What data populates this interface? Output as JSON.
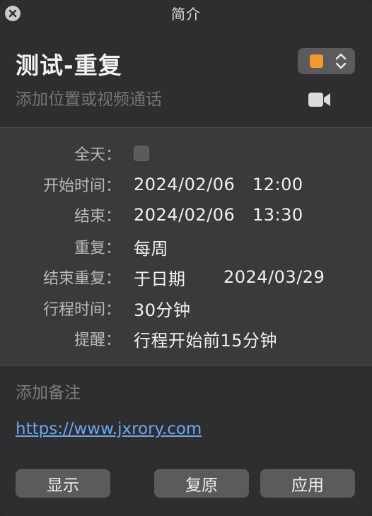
{
  "window": {
    "title": "简介"
  },
  "header": {
    "event_title": "测试-重复",
    "calendar_color": "#f39a2c",
    "location_placeholder": "添加位置或视频通话"
  },
  "details": {
    "all_day_label": "全天：",
    "start_label": "开始时间：",
    "start_date": "2024/02/06",
    "start_time": "12:00",
    "end_label": "结束：",
    "end_date": "2024/02/06",
    "end_time": "13:30",
    "repeat_label": "重复：",
    "repeat_value": "每周",
    "end_repeat_label": "结束重复：",
    "end_repeat_mode": "于日期",
    "end_repeat_date": "2024/03/29",
    "travel_label": "行程时间：",
    "travel_value": "30分钟",
    "alert_label": "提醒：",
    "alert_value": "行程开始前15分钟"
  },
  "notes": {
    "placeholder": "添加备注",
    "url": "https://www.jxrory.com"
  },
  "buttons": {
    "show": "显示",
    "revert": "复原",
    "apply": "应用"
  },
  "icons": {
    "close": "close-icon",
    "stepper": "chevron-up-down-icon",
    "video": "video-camera-icon"
  }
}
